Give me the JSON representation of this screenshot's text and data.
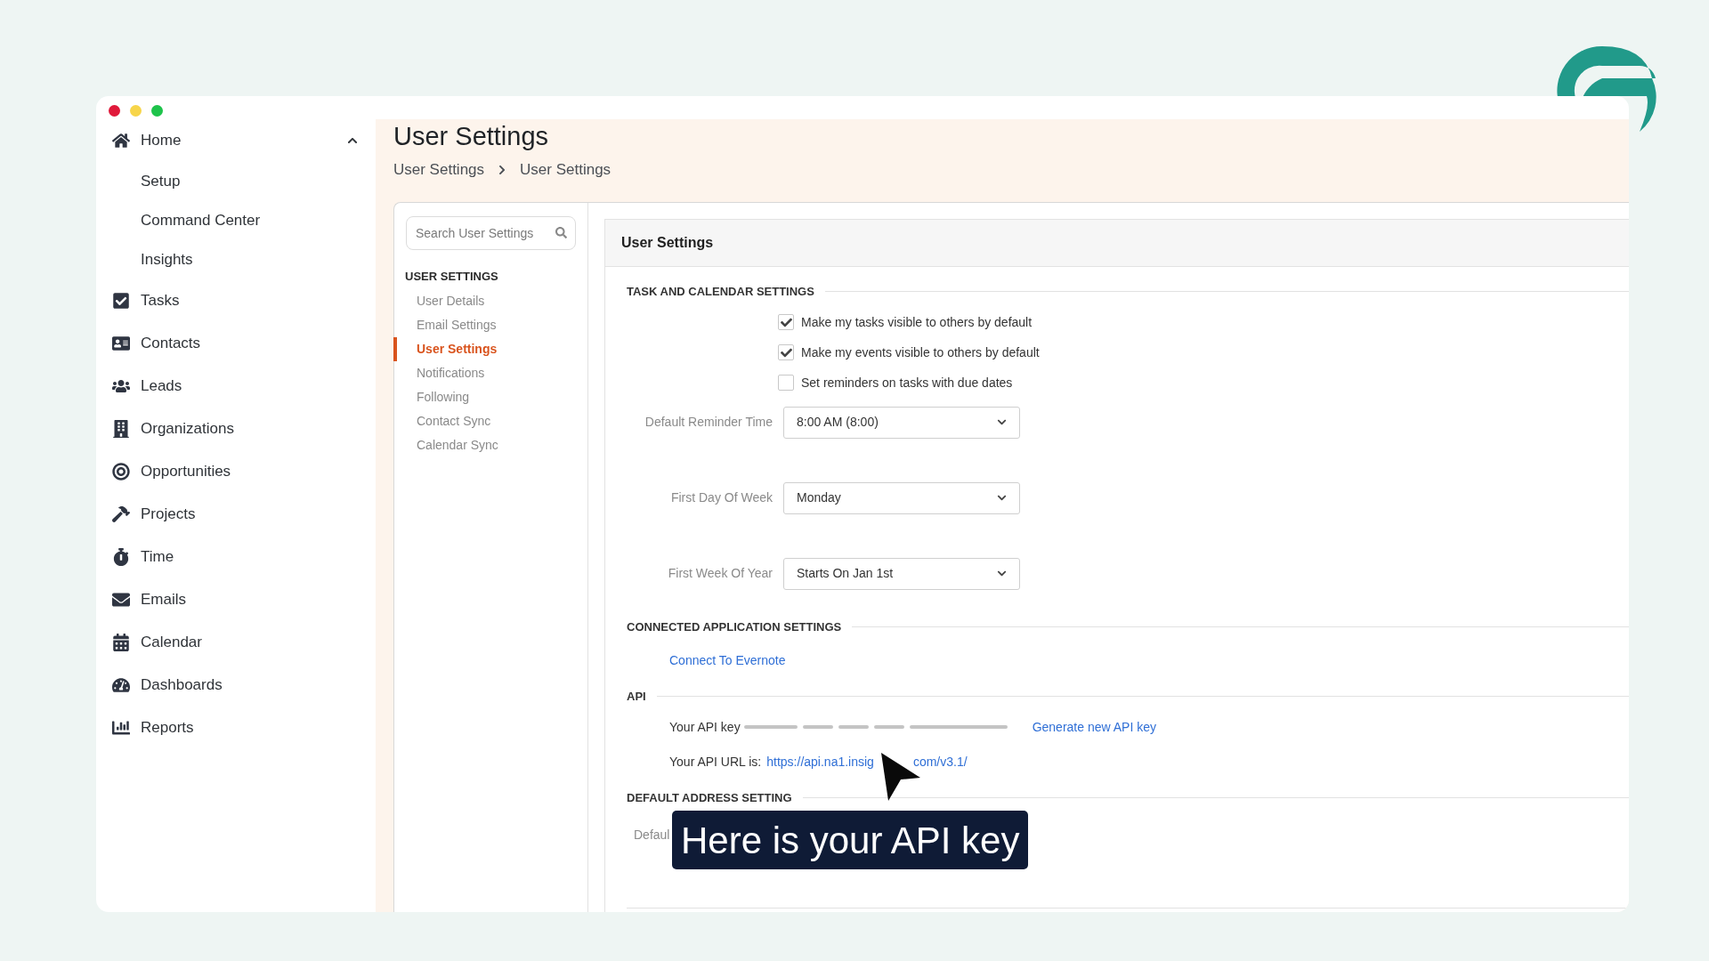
{
  "sidebar": {
    "items": [
      {
        "label": "Home",
        "expanded": true,
        "children": [
          {
            "label": "Setup"
          },
          {
            "label": "Command Center"
          },
          {
            "label": "Insights"
          }
        ]
      },
      {
        "label": "Tasks"
      },
      {
        "label": "Contacts"
      },
      {
        "label": "Leads"
      },
      {
        "label": "Organizations"
      },
      {
        "label": "Opportunities"
      },
      {
        "label": "Projects"
      },
      {
        "label": "Time"
      },
      {
        "label": "Emails"
      },
      {
        "label": "Calendar"
      },
      {
        "label": "Dashboards"
      },
      {
        "label": "Reports"
      }
    ]
  },
  "page": {
    "title": "User Settings",
    "breadcrumb": [
      "User Settings",
      "User Settings"
    ]
  },
  "settings_nav": {
    "search": {
      "placeholder": "Search User Settings"
    },
    "heading": "USER SETTINGS",
    "items": [
      {
        "label": "User Details",
        "selected": false
      },
      {
        "label": "Email Settings",
        "selected": false
      },
      {
        "label": "User Settings",
        "selected": true
      },
      {
        "label": "Notifications",
        "selected": false
      },
      {
        "label": "Following",
        "selected": false
      },
      {
        "label": "Contact Sync",
        "selected": false
      },
      {
        "label": "Calendar Sync",
        "selected": false
      }
    ]
  },
  "panel": {
    "title": "User Settings",
    "task_section": {
      "heading": "TASK AND CALENDAR SETTINGS",
      "checkboxes": [
        {
          "label": "Make my tasks visible to others by default",
          "checked": true
        },
        {
          "label": "Make my events visible to others by default",
          "checked": true
        },
        {
          "label": "Set reminders on tasks with due dates",
          "checked": false
        }
      ],
      "selects": [
        {
          "label": "Default Reminder Time",
          "value": "8:00 AM (8:00)"
        },
        {
          "label": "First Day Of Week",
          "value": "Monday"
        },
        {
          "label": "First Week Of Year",
          "value": "Starts On Jan 1st"
        }
      ]
    },
    "connected_section": {
      "heading": "CONNECTED APPLICATION SETTINGS",
      "link": "Connect To Evernote"
    },
    "api_section": {
      "heading": "API",
      "key_label": "Your API key",
      "generate_link": "Generate new API key",
      "url_label": "Your API URL is:",
      "url_start": "https://api.na1.insig",
      "url_end": "com/v3.1/"
    },
    "address_section": {
      "heading": "DEFAULT ADDRESS SETTING",
      "label": "Defaul"
    }
  },
  "caption": "Here is your API key"
}
